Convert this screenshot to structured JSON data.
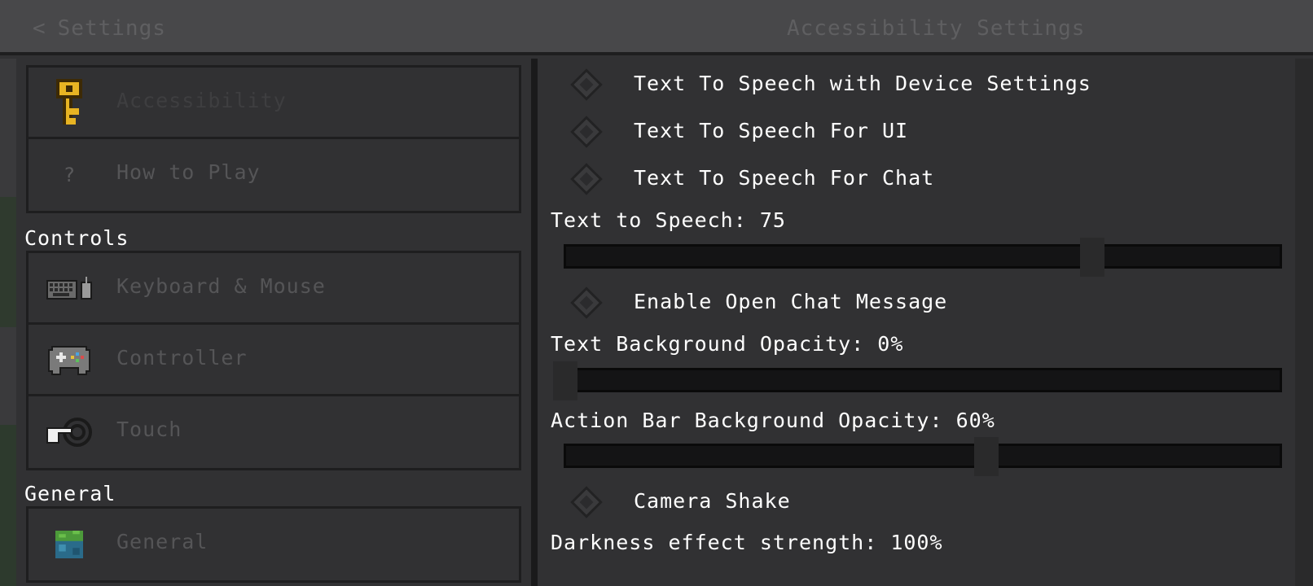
{
  "header": {
    "back_label": "Settings",
    "title": "Accessibility Settings"
  },
  "sidebar": {
    "top_items": [
      {
        "label": "Accessibility",
        "icon": "key-icon"
      },
      {
        "label": "How to Play",
        "icon": "question-icon"
      }
    ],
    "controls_heading": "Controls",
    "controls_items": [
      {
        "label": "Keyboard & Mouse",
        "icon": "keyboard-mouse-icon"
      },
      {
        "label": "Controller",
        "icon": "gamepad-icon"
      },
      {
        "label": "Touch",
        "icon": "touch-icon"
      }
    ],
    "general_heading": "General",
    "general_items": [
      {
        "label": "General",
        "icon": "grass-block-icon"
      }
    ]
  },
  "settings": {
    "tts_device": "Text To Speech with Device Settings",
    "tts_ui": "Text To Speech For UI",
    "tts_chat": "Text To Speech For Chat",
    "tts_volume_label": "Text to Speech: 75",
    "tts_volume_value": 75,
    "open_chat_message": "Enable Open Chat Message",
    "text_bg_opacity_label": "Text Background Opacity: 0%",
    "text_bg_opacity_value": 0,
    "action_bar_opacity_label": "Action Bar Background Opacity: 60%",
    "action_bar_opacity_value": 60,
    "camera_shake": "Camera Shake",
    "darkness_label": "Darkness effect strength: 100%"
  },
  "colors": {
    "header_bg": "#48484a",
    "panel_bg": "#313133",
    "muted_text": "#555557",
    "key_gold": "#e8b423"
  }
}
